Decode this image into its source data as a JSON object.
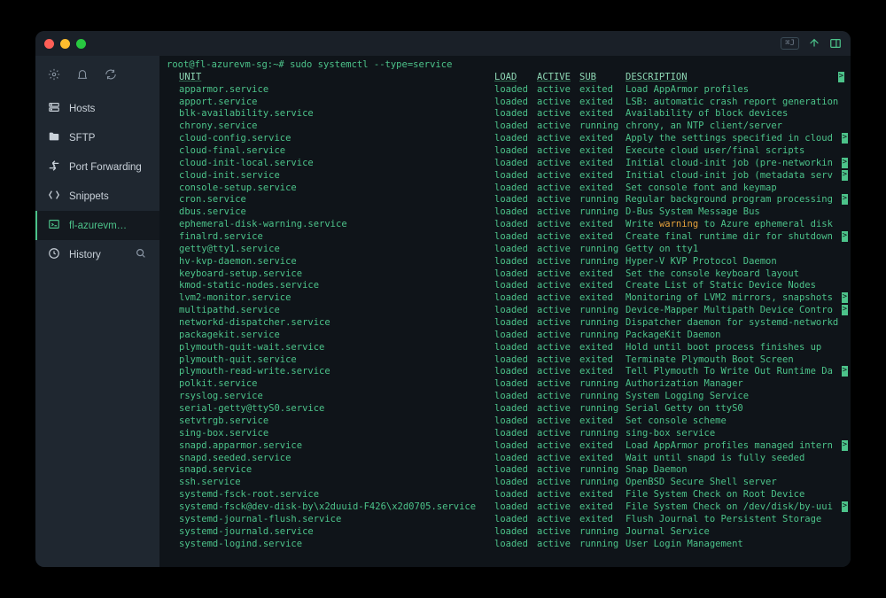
{
  "titlebar": {
    "badge": "⌘J"
  },
  "sidebar": {
    "items": [
      {
        "icon": "hosts",
        "label": "Hosts"
      },
      {
        "icon": "sftp",
        "label": "SFTP"
      },
      {
        "icon": "port",
        "label": "Port Forwarding"
      },
      {
        "icon": "snippets",
        "label": "Snippets"
      },
      {
        "icon": "terminal",
        "label": "fl-azurevm…",
        "active": true
      },
      {
        "icon": "history",
        "label": "History",
        "search": true
      }
    ]
  },
  "terminal": {
    "prompt": "root@fl-azurevm-sg:~# ",
    "command": "sudo systemctl --type=service",
    "headers": {
      "unit": "UNIT",
      "load": "LOAD",
      "active": "ACTIVE",
      "sub": "SUB",
      "desc": "DESCRIPTION"
    },
    "rows": [
      {
        "unit": "apparmor.service",
        "load": "loaded",
        "active": "active",
        "sub": "exited",
        "desc": "Load AppArmor profiles"
      },
      {
        "unit": "apport.service",
        "load": "loaded",
        "active": "active",
        "sub": "exited",
        "desc": "LSB: automatic crash report generation"
      },
      {
        "unit": "blk-availability.service",
        "load": "loaded",
        "active": "active",
        "sub": "exited",
        "desc": "Availability of block devices"
      },
      {
        "unit": "chrony.service",
        "load": "loaded",
        "active": "active",
        "sub": "running",
        "desc": "chrony, an NTP client/server"
      },
      {
        "unit": "cloud-config.service",
        "load": "loaded",
        "active": "active",
        "sub": "exited",
        "desc": "Apply the settings specified in cloud",
        "cut": true
      },
      {
        "unit": "cloud-final.service",
        "load": "loaded",
        "active": "active",
        "sub": "exited",
        "desc": "Execute cloud user/final scripts"
      },
      {
        "unit": "cloud-init-local.service",
        "load": "loaded",
        "active": "active",
        "sub": "exited",
        "desc": "Initial cloud-init job (pre-networkin",
        "cut": true
      },
      {
        "unit": "cloud-init.service",
        "load": "loaded",
        "active": "active",
        "sub": "exited",
        "desc": "Initial cloud-init job (metadata serv",
        "cut": true
      },
      {
        "unit": "console-setup.service",
        "load": "loaded",
        "active": "active",
        "sub": "exited",
        "desc": "Set console font and keymap"
      },
      {
        "unit": "cron.service",
        "load": "loaded",
        "active": "active",
        "sub": "running",
        "desc": "Regular background program processing",
        "cut": true
      },
      {
        "unit": "dbus.service",
        "load": "loaded",
        "active": "active",
        "sub": "running",
        "desc": "D-Bus System Message Bus"
      },
      {
        "unit": "ephemeral-disk-warning.service",
        "load": "loaded",
        "active": "active",
        "sub": "exited",
        "desc": "Write |warning| to Azure ephemeral disk",
        "warn": true
      },
      {
        "unit": "finalrd.service",
        "load": "loaded",
        "active": "active",
        "sub": "exited",
        "desc": "Create final runtime dir for shutdown",
        "cut": true
      },
      {
        "unit": "getty@tty1.service",
        "load": "loaded",
        "active": "active",
        "sub": "running",
        "desc": "Getty on tty1"
      },
      {
        "unit": "hv-kvp-daemon.service",
        "load": "loaded",
        "active": "active",
        "sub": "running",
        "desc": "Hyper-V KVP Protocol Daemon"
      },
      {
        "unit": "keyboard-setup.service",
        "load": "loaded",
        "active": "active",
        "sub": "exited",
        "desc": "Set the console keyboard layout"
      },
      {
        "unit": "kmod-static-nodes.service",
        "load": "loaded",
        "active": "active",
        "sub": "exited",
        "desc": "Create List of Static Device Nodes"
      },
      {
        "unit": "lvm2-monitor.service",
        "load": "loaded",
        "active": "active",
        "sub": "exited",
        "desc": "Monitoring of LVM2 mirrors, snapshots",
        "cut": true
      },
      {
        "unit": "multipathd.service",
        "load": "loaded",
        "active": "active",
        "sub": "running",
        "desc": "Device-Mapper Multipath Device Contro",
        "cut": true
      },
      {
        "unit": "networkd-dispatcher.service",
        "load": "loaded",
        "active": "active",
        "sub": "running",
        "desc": "Dispatcher daemon for systemd-networkd"
      },
      {
        "unit": "packagekit.service",
        "load": "loaded",
        "active": "active",
        "sub": "running",
        "desc": "PackageKit Daemon"
      },
      {
        "unit": "plymouth-quit-wait.service",
        "load": "loaded",
        "active": "active",
        "sub": "exited",
        "desc": "Hold until boot process finishes up"
      },
      {
        "unit": "plymouth-quit.service",
        "load": "loaded",
        "active": "active",
        "sub": "exited",
        "desc": "Terminate Plymouth Boot Screen"
      },
      {
        "unit": "plymouth-read-write.service",
        "load": "loaded",
        "active": "active",
        "sub": "exited",
        "desc": "Tell Plymouth To Write Out Runtime Da",
        "cut": true
      },
      {
        "unit": "polkit.service",
        "load": "loaded",
        "active": "active",
        "sub": "running",
        "desc": "Authorization Manager"
      },
      {
        "unit": "rsyslog.service",
        "load": "loaded",
        "active": "active",
        "sub": "running",
        "desc": "System Logging Service"
      },
      {
        "unit": "serial-getty@ttyS0.service",
        "load": "loaded",
        "active": "active",
        "sub": "running",
        "desc": "Serial Getty on ttyS0"
      },
      {
        "unit": "setvtrgb.service",
        "load": "loaded",
        "active": "active",
        "sub": "exited",
        "desc": "Set console scheme"
      },
      {
        "unit": "sing-box.service",
        "load": "loaded",
        "active": "active",
        "sub": "running",
        "desc": "sing-box service"
      },
      {
        "unit": "snapd.apparmor.service",
        "load": "loaded",
        "active": "active",
        "sub": "exited",
        "desc": "Load AppArmor profiles managed intern",
        "cut": true
      },
      {
        "unit": "snapd.seeded.service",
        "load": "loaded",
        "active": "active",
        "sub": "exited",
        "desc": "Wait until snapd is fully seeded"
      },
      {
        "unit": "snapd.service",
        "load": "loaded",
        "active": "active",
        "sub": "running",
        "desc": "Snap Daemon"
      },
      {
        "unit": "ssh.service",
        "load": "loaded",
        "active": "active",
        "sub": "running",
        "desc": "OpenBSD Secure Shell server"
      },
      {
        "unit": "systemd-fsck-root.service",
        "load": "loaded",
        "active": "active",
        "sub": "exited",
        "desc": "File System Check on Root Device"
      },
      {
        "unit": "systemd-fsck@dev-disk-by\\x2duuid-F426\\x2d0705.service",
        "load": "loaded",
        "active": "active",
        "sub": "exited",
        "desc": "File System Check on /dev/disk/by-uui",
        "cut": true
      },
      {
        "unit": "systemd-journal-flush.service",
        "load": "loaded",
        "active": "active",
        "sub": "exited",
        "desc": "Flush Journal to Persistent Storage"
      },
      {
        "unit": "systemd-journald.service",
        "load": "loaded",
        "active": "active",
        "sub": "running",
        "desc": "Journal Service"
      },
      {
        "unit": "systemd-logind.service",
        "load": "loaded",
        "active": "active",
        "sub": "running",
        "desc": "User Login Management"
      }
    ]
  }
}
